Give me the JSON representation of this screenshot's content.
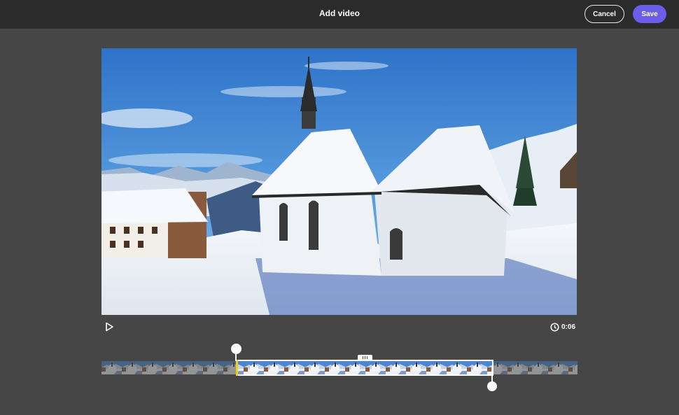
{
  "header": {
    "title": "Add video",
    "cancel_label": "Cancel",
    "save_label": "Save"
  },
  "colors": {
    "topbar": "#2b2b2b",
    "background": "#464646",
    "save_button": "#6a5ee8",
    "playhead": "#f0d21a"
  },
  "player": {
    "play_icon": "play-icon",
    "duration_icon": "clock-icon",
    "duration": "0:06"
  },
  "trim": {
    "grip_icon": "drag-grip-icon"
  }
}
